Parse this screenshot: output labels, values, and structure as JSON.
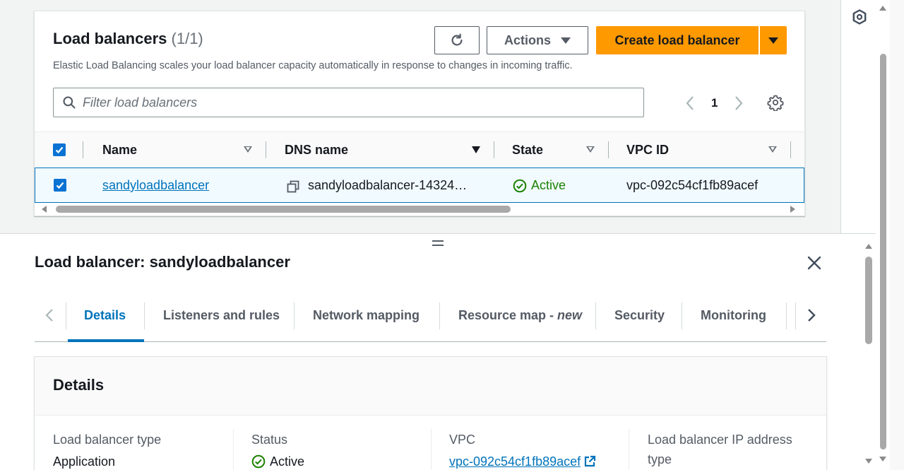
{
  "lb_list": {
    "title": "Load balancers",
    "count": "(1/1)",
    "description": "Elastic Load Balancing scales your load balancer capacity automatically in response to changes in incoming traffic.",
    "actions_label": "Actions",
    "create_label": "Create load balancer",
    "filter_placeholder": "Filter load balancers",
    "page_number": "1",
    "columns": {
      "name": "Name",
      "dns": "DNS name",
      "state": "State",
      "vpc": "VPC ID"
    },
    "rows": [
      {
        "name": "sandyloadbalancer",
        "dns": "sandyloadbalancer-14324…",
        "state": "Active",
        "vpc": "vpc-092c54cf1fb89acef"
      }
    ]
  },
  "split_panel": {
    "title": "Load balancer: sandyloadbalancer",
    "tabs": [
      {
        "label": "Details"
      },
      {
        "label": "Listeners and rules"
      },
      {
        "label": "Network mapping"
      },
      {
        "label": "Resource map - ",
        "suffix": "new"
      },
      {
        "label": "Security"
      },
      {
        "label": "Monitoring"
      }
    ],
    "details": {
      "heading": "Details",
      "fields": [
        {
          "key": "Load balancer type",
          "value": "Application"
        },
        {
          "key": "Status",
          "value": "Active"
        },
        {
          "key": "VPC",
          "value": "vpc-092c54cf1fb89acef"
        },
        {
          "key": "Load balancer IP address",
          "value": "type"
        }
      ]
    }
  },
  "colors": {
    "accent": "#0073bb",
    "primary_button": "#ff9900",
    "success": "#1d8102"
  }
}
